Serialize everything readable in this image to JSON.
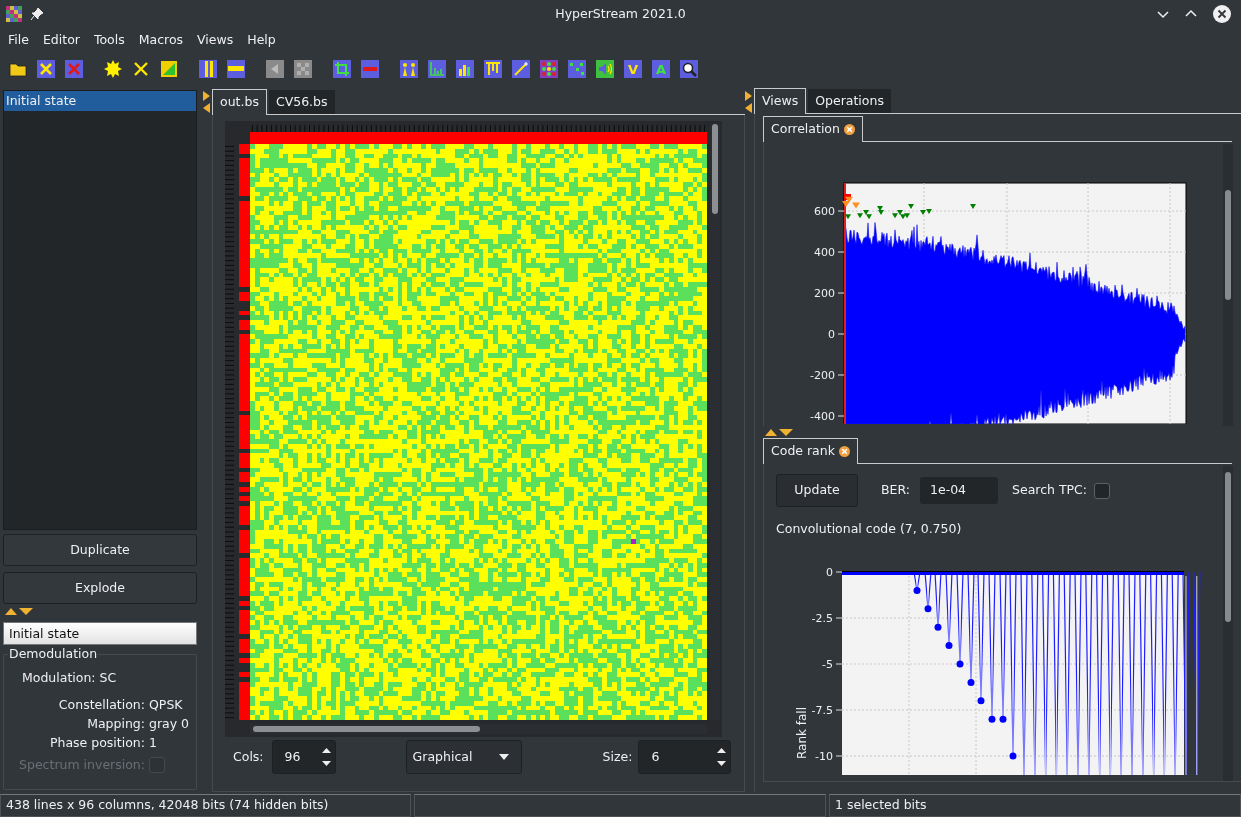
{
  "window": {
    "title": "HyperStream 2021.0"
  },
  "menu": [
    "File",
    "Editor",
    "Tools",
    "Macros",
    "Views",
    "Help"
  ],
  "toolbar": {
    "letter_icons": [
      "V",
      "A"
    ]
  },
  "left_panel": {
    "states": [
      {
        "label": "Initial state",
        "selected": true
      }
    ],
    "buttons": [
      "Duplicate",
      "Explode"
    ],
    "state_name": "Initial state",
    "group_title": "Demodulation",
    "modulation": {
      "label": "Modulation:",
      "value": "SC"
    },
    "properties": [
      {
        "label": "Constellation:",
        "value": "QPSK"
      },
      {
        "label": "Mapping:",
        "value": "gray 0"
      },
      {
        "label": "Phase position:",
        "value": "1"
      }
    ],
    "spectrum_inversion": {
      "label": "Spectrum inversion:",
      "checked": false,
      "disabled": true
    }
  },
  "editor": {
    "tabs": [
      {
        "label": "out.bs",
        "selected": true
      },
      {
        "label": "CV56.bs",
        "selected": false
      }
    ],
    "cols": {
      "label": "Cols:",
      "value": "96"
    },
    "display_mode": {
      "value": "Graphical"
    },
    "size": {
      "label": "Size:",
      "value": "6"
    }
  },
  "right_panel": {
    "tabs": [
      {
        "label": "Views",
        "selected": true
      },
      {
        "label": "Operations",
        "selected": false
      }
    ],
    "correlation": {
      "tab": "Correlation",
      "y_tick_labels": [
        "600",
        "400",
        "200",
        "0",
        "-200",
        "-400"
      ]
    },
    "code_rank": {
      "tab": "Code rank",
      "update_button": "Update",
      "ber": {
        "label": "BER:",
        "value": "1e-04"
      },
      "search_tpc": {
        "label": "Search TPC:",
        "checked": false
      },
      "result": "Convolutional code (7, 0.750)",
      "y_tick_labels": [
        "0",
        "-2.5",
        "-5",
        "-7.5",
        "-10"
      ],
      "ylabel": "Rank fall"
    }
  },
  "status_bar": {
    "left": "438 lines x 96 columns, 42048 bits (74 hidden bits)",
    "right": "1 selected bits"
  }
}
